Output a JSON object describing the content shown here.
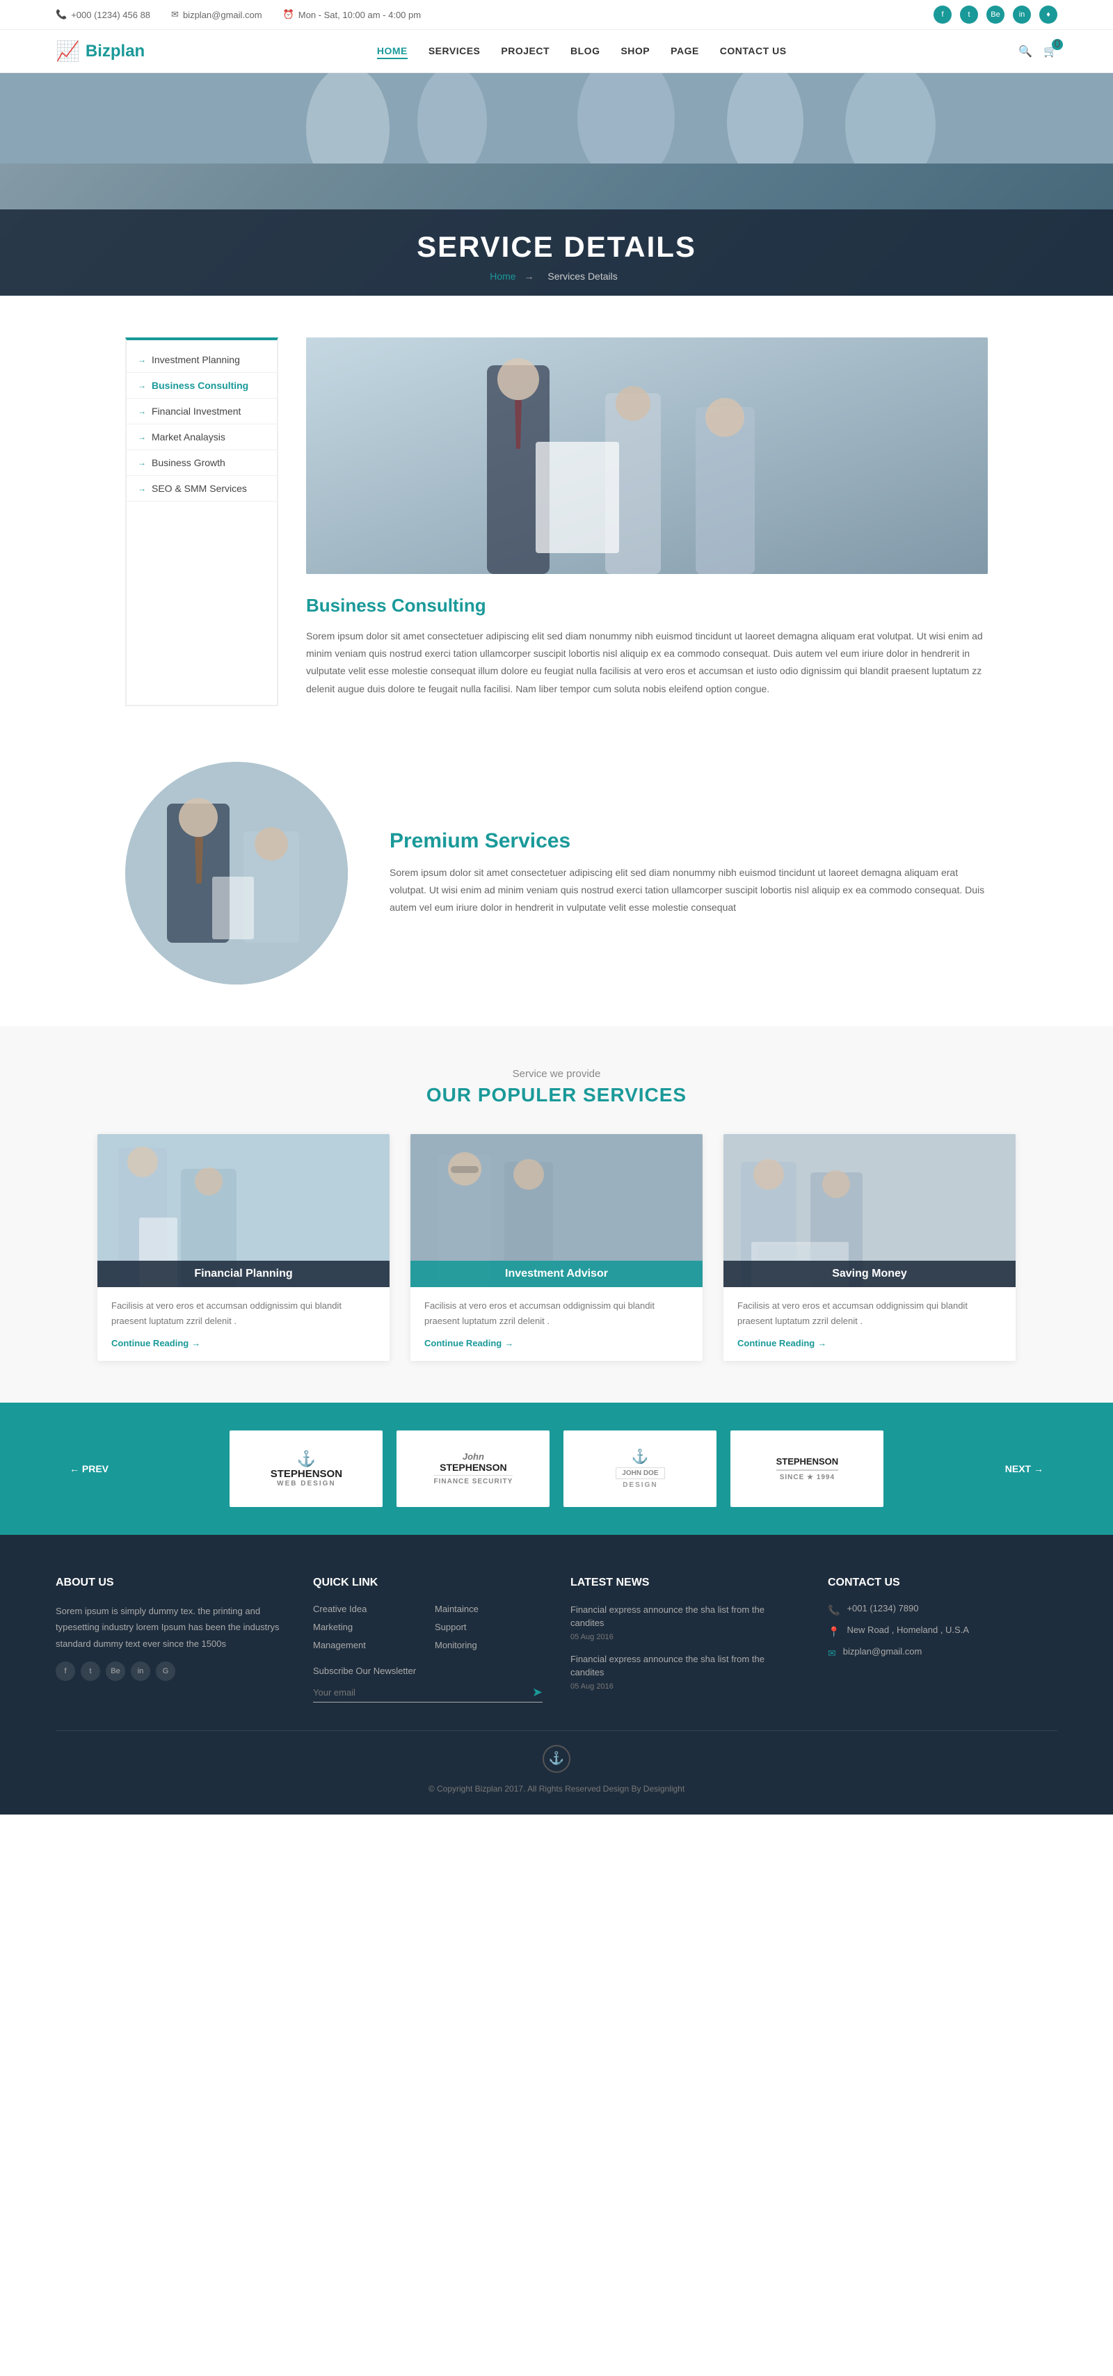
{
  "topbar": {
    "phone": "+000 (1234) 456 88",
    "email": "bizplan@gmail.com",
    "hours": "Mon - Sat, 10:00 am - 4:00 pm",
    "socials": [
      "f",
      "t",
      "Be",
      "in",
      "♦"
    ]
  },
  "navbar": {
    "brand": "Bizplan",
    "links": [
      {
        "label": "HOME",
        "active": true
      },
      {
        "label": "SERVICES",
        "active": false
      },
      {
        "label": "PROJECT",
        "active": false
      },
      {
        "label": "BLOG",
        "active": false
      },
      {
        "label": "SHOP",
        "active": false
      },
      {
        "label": "PAGE",
        "active": false
      },
      {
        "label": "CONTACT US",
        "active": false
      }
    ],
    "cart_count": "0"
  },
  "hero": {
    "title": "SERVICE DETAILS",
    "breadcrumb_home": "Home",
    "breadcrumb_current": "Services Details"
  },
  "sidebar": {
    "items": [
      {
        "label": "Investment Planning",
        "active": false
      },
      {
        "label": "Business Consulting",
        "active": true
      },
      {
        "label": "Financial Investment",
        "active": false
      },
      {
        "label": "Market Analaysis",
        "active": false
      },
      {
        "label": "Business Growth",
        "active": false
      },
      {
        "label": "SEO & SMM Services",
        "active": false
      }
    ]
  },
  "service_detail": {
    "title": "Business Consulting",
    "description": "Sorem ipsum dolor sit amet consectetuer adipiscing elit sed diam nonummy nibh euismod tincidunt ut laoreet demagna aliquam erat volutpat. Ut wisi enim ad minim veniam quis nostrud exerci tation ullamcorper suscipit lobortis nisl aliquip ex ea commodo consequat. Duis autem vel eum iriure dolor in hendrerit in vulputate velit esse molestie consequat illum dolore eu feugiat nulla facilisis at vero eros et accumsan et iusto odio dignissim qui blandit praesent luptatum zz delenit augue duis dolore te feugait nulla facilisi. Nam liber tempor cum soluta nobis eleifend option congue."
  },
  "premium": {
    "title": "Premium Services",
    "description": "Sorem ipsum dolor sit amet consectetuer adipiscing elit sed diam nonummy nibh euismod tincidunt ut laoreet demagna aliquam erat volutpat. Ut wisi enim ad minim veniam quis nostrud exerci tation ullamcorper suscipit lobortis nisl aliquip ex ea commodo consequat. Duis autem vel eum iriure dolor in hendrerit in vulputate velit esse molestie consequat"
  },
  "popular_services": {
    "subtitle": "Service we provide",
    "title": "OUR POPULER SERVICES",
    "cards": [
      {
        "label": "Financial Planning",
        "label_style": "dark",
        "description": "Facilisis at vero eros et accumsan oddignissim qui blandit praesent luptatum zzril delenit .",
        "link": "Continue Reading"
      },
      {
        "label": "Investment Advisor",
        "label_style": "teal",
        "description": "Facilisis at vero eros et accumsan oddignissim qui blandit praesent luptatum zzril delenit .",
        "link": "Continue Reading"
      },
      {
        "label": "Saving Money",
        "label_style": "dark",
        "description": "Facilisis at vero eros et accumsan oddignissim qui blandit praesent luptatum zzril delenit .",
        "link": "Continue Reading"
      }
    ]
  },
  "partners": {
    "prev": "← PREV",
    "next": "NEXT →",
    "logos": [
      {
        "line1": "STEPHENSON",
        "line2": "WEB DESIGN",
        "sub": ""
      },
      {
        "line1": "John",
        "line2": "STEPHENSON",
        "sub": "FINANCE SECURITY"
      },
      {
        "line1": "JOHN DOE",
        "line2": "DESIGN",
        "sub": ""
      },
      {
        "line1": "STEPHENSON",
        "line2": "SINCE ★ 1994",
        "sub": ""
      }
    ]
  },
  "footer": {
    "about": {
      "title": "ABOUT US",
      "text": "Sorem ipsum is simply dummy tex. the printing and typesetting industry lorem Ipsum has been the industrys standard dummy text ever since the 1500s"
    },
    "quick_link": {
      "title": "QUICK LINK",
      "links": [
        "Creative Idea",
        "Maintaince",
        "Marketing",
        "Support",
        "Management",
        "Monitoring"
      ]
    },
    "latest_news": {
      "title": "LATEST NEWS",
      "items": [
        {
          "text": "Financial express announce the sha list from the candites",
          "date": "05 Aug 2016"
        },
        {
          "text": "Financial express announce the sha list from the candites",
          "date": "05 Aug 2016"
        }
      ]
    },
    "contact": {
      "title": "CONTACT US",
      "phone": "+001 (1234) 7890",
      "address": "New Road , Homeland , U.S.A",
      "email": "bizplan@gmail.com"
    },
    "newsletter": {
      "label": "Subscribe Our Newsletter",
      "placeholder": "Your email"
    },
    "copyright": "© Copyright Bizplan 2017. All Rights Reserved Design By Designlight"
  }
}
